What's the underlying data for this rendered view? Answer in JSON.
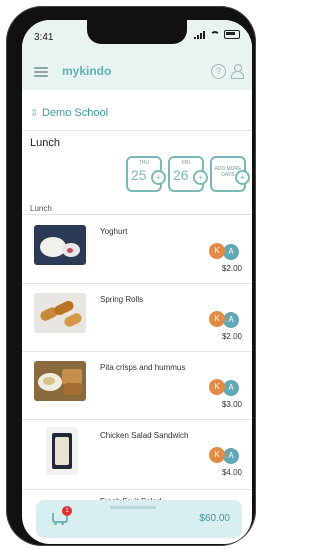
{
  "status": {
    "time": "3:41"
  },
  "app": {
    "brand": "mykindo"
  },
  "school": {
    "name": "Demo School"
  },
  "section": {
    "title": "Lunch"
  },
  "dates": [
    {
      "dow": "THU",
      "day": "25"
    },
    {
      "dow": "FRI",
      "day": "26"
    },
    {
      "dow": "",
      "day": "",
      "more": "ADD MORE DAYS"
    }
  ],
  "list": {
    "label": "Lunch",
    "items": [
      {
        "name": "Yoghurt",
        "price": "$2.00"
      },
      {
        "name": "Spring Rolls",
        "price": "$2.00"
      },
      {
        "name": "Pita crisps and hummus",
        "price": "$3.00"
      },
      {
        "name": "Chicken Salad Sandwich",
        "price": "$4.00"
      },
      {
        "name": "Fresh Fruit Salad",
        "price": ""
      }
    ]
  },
  "badges": {
    "k": "K",
    "a": "A"
  },
  "cart": {
    "count": "1",
    "total": "$60.00"
  },
  "icons": {
    "menu": "hamburger-icon",
    "help": "help-icon",
    "account": "user-icon",
    "school": "school-selector-icon",
    "cart": "cart-icon"
  },
  "colors": {
    "accent": "#5db2b5",
    "orange": "#e38b46",
    "blue": "#61a8b4",
    "cart_bg": "#d9eef0"
  }
}
